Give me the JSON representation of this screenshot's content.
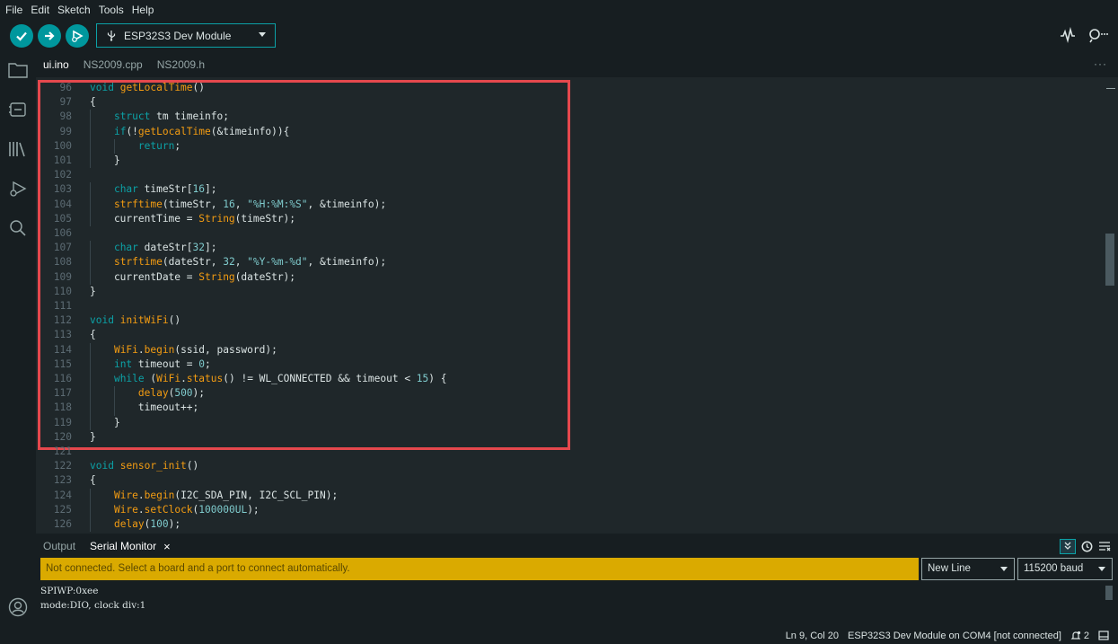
{
  "menu": [
    "File",
    "Edit",
    "Sketch",
    "Tools",
    "Help"
  ],
  "toolbar": {
    "board": "ESP32S3 Dev Module",
    "icons": [
      "verify-icon",
      "upload-icon",
      "debug-icon",
      "serial-plotter-icon",
      "serial-monitor-icon"
    ]
  },
  "sidebar": [
    "folder-icon",
    "boards-manager-icon",
    "library-icon",
    "debug-icon",
    "search-icon",
    "account-icon"
  ],
  "tabs": [
    {
      "label": "ui.ino",
      "active": true
    },
    {
      "label": "NS2009.cpp",
      "active": false
    },
    {
      "label": "NS2009.h",
      "active": false
    }
  ],
  "tabs_more": "···",
  "editor": {
    "lines": [
      {
        "n": "96",
        "code": "void getLocalTime()"
      },
      {
        "n": "97",
        "code": "{"
      },
      {
        "n": "98",
        "code": "    struct tm timeinfo;"
      },
      {
        "n": "99",
        "code": "    if(!getLocalTime(&timeinfo)){"
      },
      {
        "n": "100",
        "code": "        return;"
      },
      {
        "n": "101",
        "code": "    }"
      },
      {
        "n": "102",
        "code": ""
      },
      {
        "n": "103",
        "code": "    char timeStr[16];"
      },
      {
        "n": "104",
        "code": "    strftime(timeStr, 16, \"%H:%M:%S\", &timeinfo);"
      },
      {
        "n": "105",
        "code": "    currentTime = String(timeStr);"
      },
      {
        "n": "106",
        "code": ""
      },
      {
        "n": "107",
        "code": "    char dateStr[32];"
      },
      {
        "n": "108",
        "code": "    strftime(dateStr, 32, \"%Y-%m-%d\", &timeinfo);"
      },
      {
        "n": "109",
        "code": "    currentDate = String(dateStr);"
      },
      {
        "n": "110",
        "code": "}"
      },
      {
        "n": "111",
        "code": ""
      },
      {
        "n": "112",
        "code": "void initWiFi()"
      },
      {
        "n": "113",
        "code": "{"
      },
      {
        "n": "114",
        "code": "    WiFi.begin(ssid, password);"
      },
      {
        "n": "115",
        "code": "    int timeout = 0;"
      },
      {
        "n": "116",
        "code": "    while (WiFi.status() != WL_CONNECTED && timeout < 15) {"
      },
      {
        "n": "117",
        "code": "        delay(500);"
      },
      {
        "n": "118",
        "code": "        timeout++;"
      },
      {
        "n": "119",
        "code": "    }"
      },
      {
        "n": "120",
        "code": "}"
      },
      {
        "n": "121",
        "code": ""
      },
      {
        "n": "122",
        "code": "void sensor_init()"
      },
      {
        "n": "123",
        "code": "{"
      },
      {
        "n": "124",
        "code": "    Wire.begin(I2C_SDA_PIN, I2C_SCL_PIN);"
      },
      {
        "n": "125",
        "code": "    Wire.setClock(100000UL);"
      },
      {
        "n": "126",
        "code": "    delay(100);"
      }
    ]
  },
  "panel": {
    "tabs": [
      {
        "label": "Output",
        "active": false
      },
      {
        "label": "Serial Monitor",
        "active": true
      }
    ],
    "close_label": "×",
    "warning": "Not connected. Select a board and a port to connect automatically.",
    "line_ending": "New Line",
    "baud": "115200 baud",
    "output": [
      "SPIWP:0xee",
      "mode:DIO, clock div:1"
    ]
  },
  "status": {
    "position": "Ln 9, Col 20",
    "board_port": "ESP32S3 Dev Module on COM4 [not connected]",
    "notifications": "2"
  },
  "colors": {
    "accent": "#00979d",
    "highlight_box": "#e5484d",
    "warning_bg": "#daaa00"
  }
}
